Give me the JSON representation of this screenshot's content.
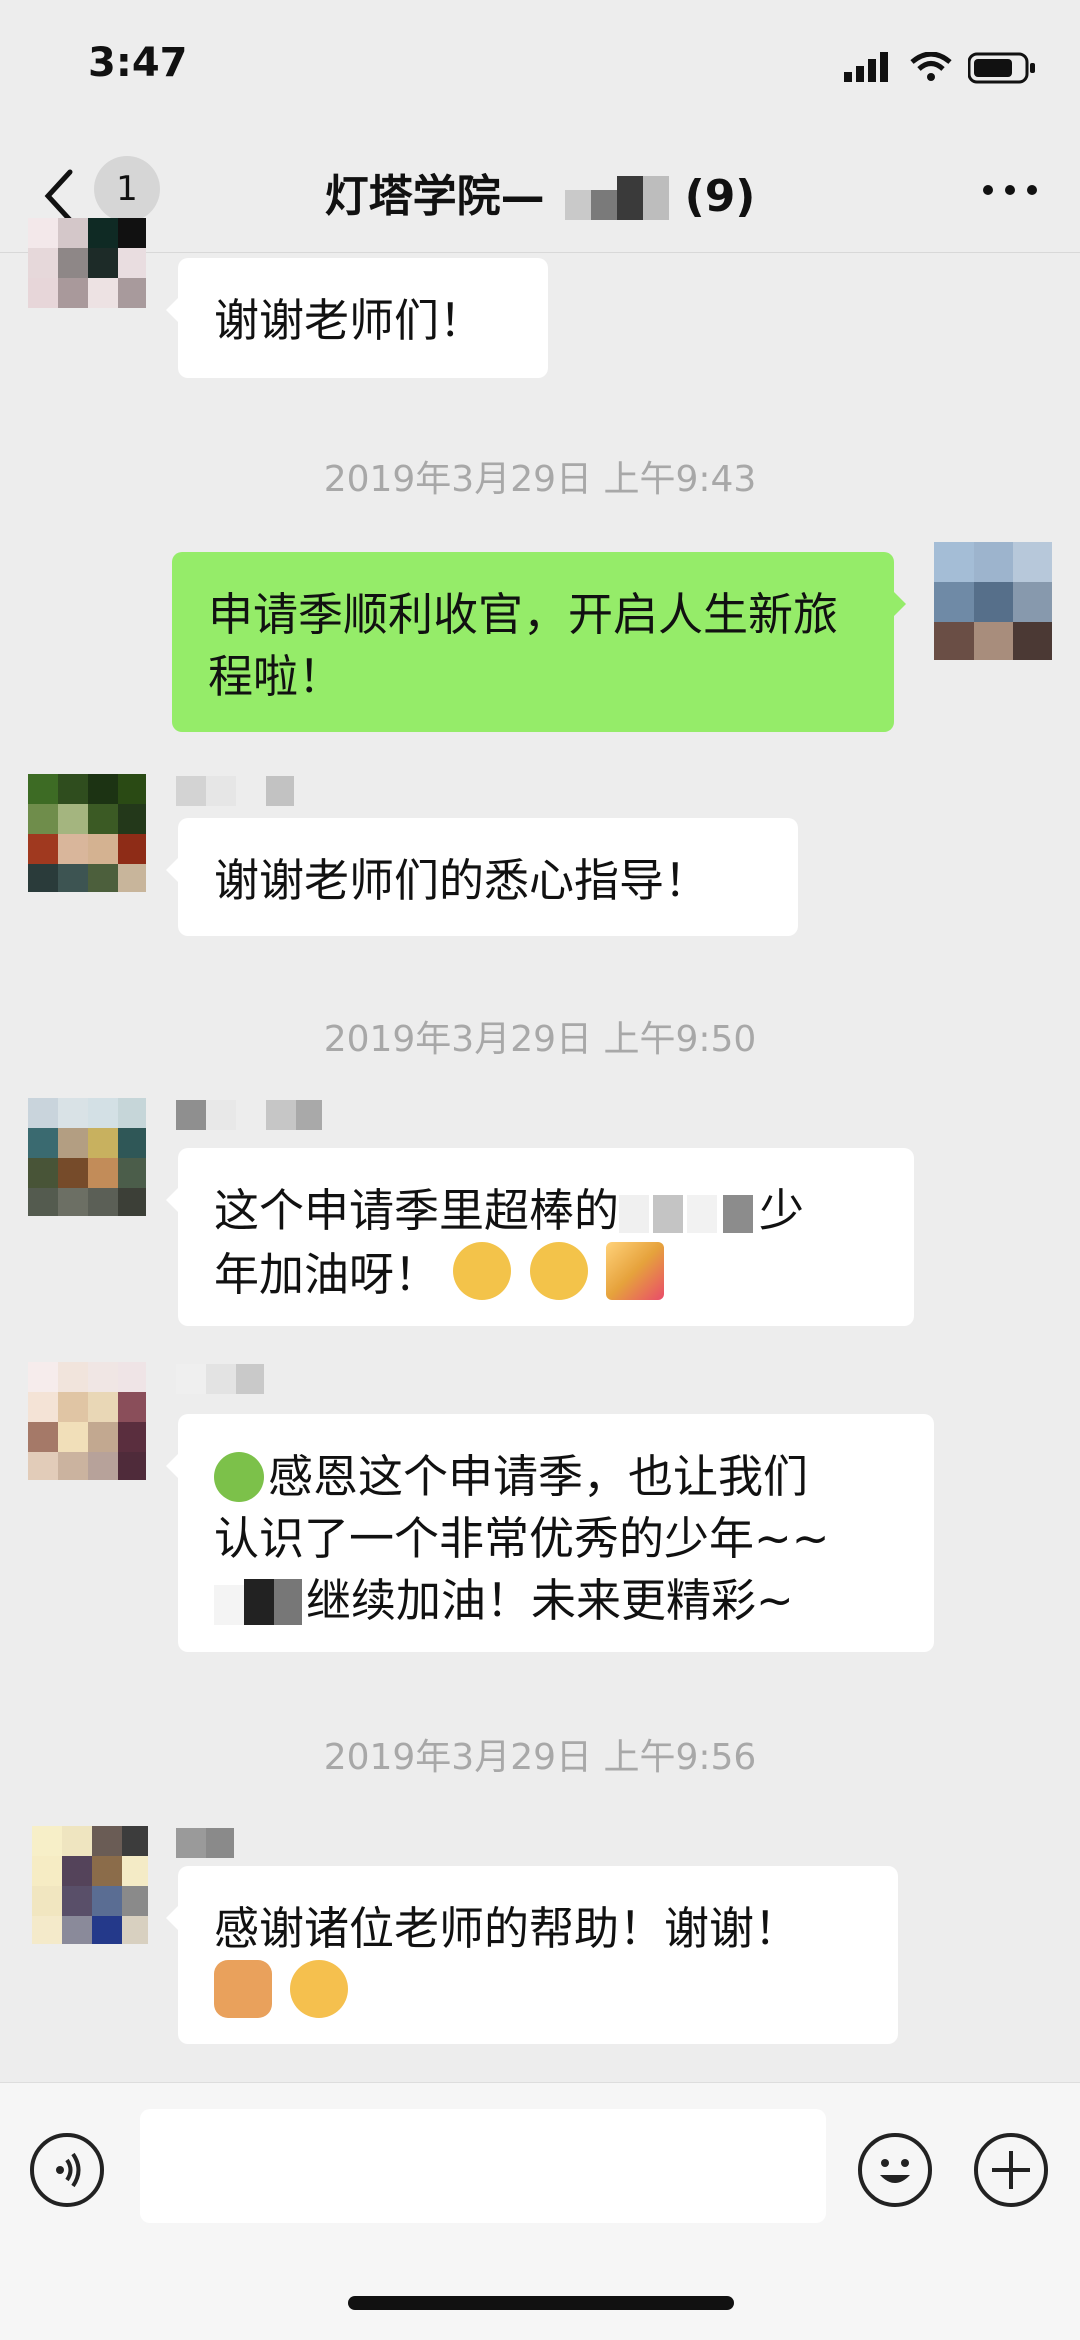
{
  "status_bar": {
    "time": "3:47"
  },
  "nav": {
    "badge": "1",
    "title_prefix": "灯塔学院—",
    "title_suffix": "(9)"
  },
  "messages": [
    {
      "text": "谢谢老师们！"
    },
    {
      "timestamp": "2019年3月29日 上午9:43"
    },
    {
      "text": "申请季顺利收官，开启人生新旅程啦！"
    },
    {
      "text": "谢谢老师们的悉心指导！"
    },
    {
      "timestamp": "2019年3月29日 上午9:50"
    },
    {
      "text_a": "这个申请季里超棒的",
      "text_b": "少",
      "text_c": "年加油呀！"
    },
    {
      "text_a": "感恩这个申请季，也让我们",
      "text_b": "认识了一个非常优秀的少年~~",
      "text_c": "继续加油！未来更精彩~"
    },
    {
      "timestamp": "2019年3月29日 上午9:56"
    },
    {
      "text_a": "感谢诸位老师的帮助！谢谢！"
    }
  ],
  "colors": {
    "background": "#EDEDED",
    "own_bubble": "#95EC69",
    "other_bubble": "#FFFFFF",
    "timestamp": "#A8A8A8"
  },
  "icons": [
    "back-chevron-icon",
    "more-dots-icon",
    "voice-icon",
    "emoji-icon",
    "plus-icon"
  ]
}
